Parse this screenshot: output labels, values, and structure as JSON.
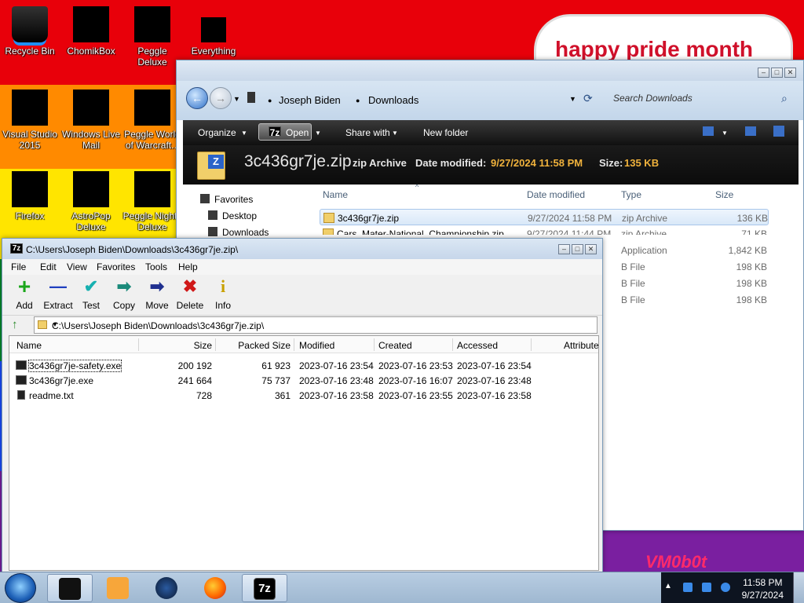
{
  "desktop": {
    "icons": [
      {
        "label": "Recycle Bin",
        "icon": "recycle-bin-icon"
      },
      {
        "label": "ChomikBox",
        "icon": "chomikbox-icon"
      },
      {
        "label": "Peggle Deluxe",
        "icon": "peggle-icon"
      },
      {
        "label": "Everything",
        "icon": "everything-icon"
      },
      {
        "label": "Visual Studio 2015",
        "icon": "visual-studio-icon"
      },
      {
        "label": "Windows Live Mail",
        "icon": "mail-icon"
      },
      {
        "label": "Peggle World of Warcraft...",
        "icon": "peggle-wow-icon"
      },
      {
        "label": "Firefox",
        "icon": "firefox-icon"
      },
      {
        "label": "AstroPop Deluxe",
        "icon": "astropop-icon"
      },
      {
        "label": "Peggle Nights Deluxe",
        "icon": "peggle-nights-icon"
      }
    ],
    "banner_text": "happy pride month",
    "watermark_text": "VM0b0t"
  },
  "explorer": {
    "breadcrumb": [
      "Joseph Biden",
      "Downloads"
    ],
    "search_placeholder": "Search Downloads",
    "commands": {
      "organize": "Organize",
      "open": "Open",
      "share_with": "Share with",
      "new_folder": "New folder"
    },
    "details": {
      "name": "3c436gr7je.zip",
      "type": "zip Archive",
      "modified_label": "Date modified:",
      "modified_value": "9/27/2024 11:58 PM",
      "size_label": "Size:",
      "size_value": "135 KB"
    },
    "nav": [
      "Favorites",
      "Desktop",
      "Downloads"
    ],
    "columns": [
      "Name",
      "Date modified",
      "Type",
      "Size"
    ],
    "files": [
      {
        "name": "3c436gr7je.zip",
        "date": "9/27/2024 11:58 PM",
        "type": "zip Archive",
        "size": "136 KB"
      },
      {
        "name": "Cars_Mater-National_Championship.zip",
        "date": "9/27/2024 11:44 PM",
        "type": "zip Archive",
        "size": "71 KB"
      },
      {
        "name": "",
        "date": "",
        "type": "Application",
        "size": "1,842 KB"
      },
      {
        "name": "",
        "date": "",
        "type": "B File",
        "size": "198 KB"
      },
      {
        "name": "",
        "date": "",
        "type": "B File",
        "size": "198 KB"
      },
      {
        "name": "",
        "date": "",
        "type": "B File",
        "size": "198 KB"
      }
    ]
  },
  "zip": {
    "title": "C:\\Users\\Joseph Biden\\Downloads\\3c436gr7je.zip\\",
    "menu": [
      "File",
      "Edit",
      "View",
      "Favorites",
      "Tools",
      "Help"
    ],
    "tools": [
      {
        "label": "Add",
        "glyph": "+",
        "color": "#1aa61a"
      },
      {
        "label": "Extract",
        "glyph": "—",
        "color": "#1f3fbf"
      },
      {
        "label": "Test",
        "glyph": "✔",
        "color": "#17b0b0"
      },
      {
        "label": "Copy",
        "glyph": "➡",
        "color": "#1a8a7a"
      },
      {
        "label": "Move",
        "glyph": "➡",
        "color": "#1f2f8f"
      },
      {
        "label": "Delete",
        "glyph": "✖",
        "color": "#d01818"
      },
      {
        "label": "Info",
        "glyph": "i",
        "color": "#c8a000"
      }
    ],
    "path": "C:\\Users\\Joseph Biden\\Downloads\\3c436gr7je.zip\\",
    "columns": [
      "Name",
      "Size",
      "Packed Size",
      "Modified",
      "Created",
      "Accessed",
      "Attributes"
    ],
    "rows": [
      {
        "name": "3c436gr7je-safety.exe",
        "size": "200 192",
        "packed": "61 923",
        "modified": "2023-07-16 23:54",
        "created": "2023-07-16 23:53",
        "accessed": "2023-07-16 23:54"
      },
      {
        "name": "3c436gr7je.exe",
        "size": "241 664",
        "packed": "75 737",
        "modified": "2023-07-16 23:48",
        "created": "2023-07-16 16:07",
        "accessed": "2023-07-16 23:48"
      },
      {
        "name": "readme.txt",
        "size": "728",
        "packed": "361",
        "modified": "2023-07-16 23:58",
        "created": "2023-07-16 23:55",
        "accessed": "2023-07-16 23:58"
      }
    ]
  },
  "taskbar": {
    "seven_zip_label": "7z",
    "time": "11:58 PM",
    "date": "9/27/2024"
  }
}
